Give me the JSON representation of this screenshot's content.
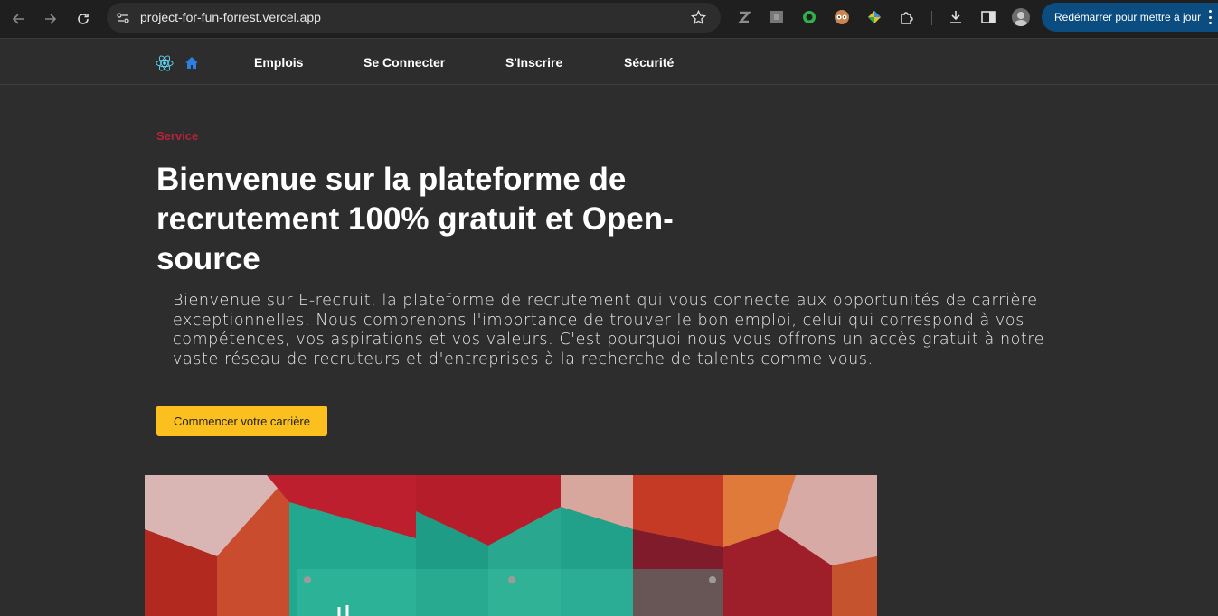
{
  "browser": {
    "url": "project-for-fun-forrest.vercel.app",
    "restart_label": "Redémarrer pour mettre à jour",
    "icons": [
      "back-icon",
      "forward-icon",
      "reload-icon",
      "site-info-icon",
      "bookmark-star-icon",
      "extensions-icon",
      "download-icon",
      "sidepanel-icon",
      "profile-avatar",
      "menu-icon"
    ]
  },
  "nav": {
    "links": [
      "Emplois",
      "Se Connecter",
      "S'Inscrire",
      "Sécurité"
    ]
  },
  "hero": {
    "eyebrow": "Service",
    "title": "Bienvenue sur la plateforme de recrutement 100% gratuit et Open-source",
    "text": "Bienvenue sur E-recruit, la plateforme de recrutement qui vous connecte aux opportunités de carrière exceptionnelles. Nous comprenons l'importance de trouver le bon emploi, celui qui correspond à vos compétences, vos aspirations et vos valeurs. C'est pourquoi nous vous offrons un accès gratuit à notre vaste réseau de recruteurs et d'entreprises à la recherche de talents comme vous.",
    "cta": "Commencer votre carrière"
  },
  "colors": {
    "accent": "#b8223c",
    "cta": "#fbbf1e",
    "background": "#2d2d2d",
    "restart_button": "#0b4d80"
  }
}
